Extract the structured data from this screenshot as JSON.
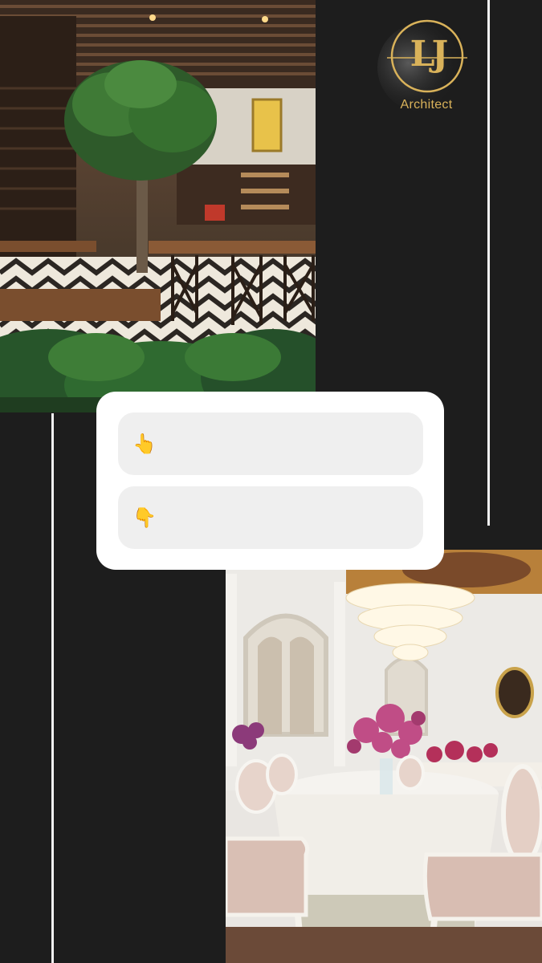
{
  "brand": {
    "logo_letters": "LJ",
    "name": "Architect",
    "gold": "#d9b25a"
  },
  "images": {
    "top": "restaurant-interior-photo",
    "bottom": "banquet-hall-photo"
  },
  "poll": {
    "options": [
      {
        "icon": "pointing-up-hand-icon",
        "emoji": "👆",
        "label": ""
      },
      {
        "icon": "pointing-down-hand-icon",
        "emoji": "👇",
        "label": ""
      }
    ]
  },
  "colors": {
    "background": "#1d1d1d",
    "card": "#ffffff",
    "option": "#efefef",
    "lines": "#f2f2f2"
  }
}
